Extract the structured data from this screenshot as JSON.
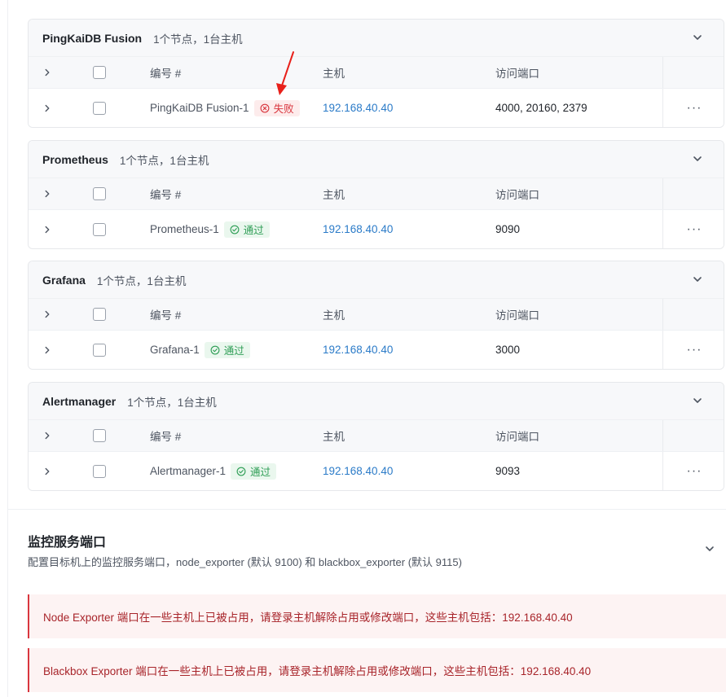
{
  "groups": [
    {
      "title": "PingKaiDB Fusion",
      "summary": "1个节点，1台主机",
      "columns": {
        "id": "编号 #",
        "host": "主机",
        "port": "访问端口"
      },
      "row": {
        "id": "PingKaiDB Fusion-1",
        "status": "失败",
        "status_type": "fail",
        "host": "192.168.40.40",
        "port": "4000, 20160, 2379",
        "more": "···"
      }
    },
    {
      "title": "Prometheus",
      "summary": "1个节点，1台主机",
      "columns": {
        "id": "编号 #",
        "host": "主机",
        "port": "访问端口"
      },
      "row": {
        "id": "Prometheus-1",
        "status": "通过",
        "status_type": "pass",
        "host": "192.168.40.40",
        "port": "9090",
        "more": "···"
      }
    },
    {
      "title": "Grafana",
      "summary": "1个节点，1台主机",
      "columns": {
        "id": "编号 #",
        "host": "主机",
        "port": "访问端口"
      },
      "row": {
        "id": "Grafana-1",
        "status": "通过",
        "status_type": "pass",
        "host": "192.168.40.40",
        "port": "3000",
        "more": "···"
      }
    },
    {
      "title": "Alertmanager",
      "summary": "1个节点，1台主机",
      "columns": {
        "id": "编号 #",
        "host": "主机",
        "port": "访问端口"
      },
      "row": {
        "id": "Alertmanager-1",
        "status": "通过",
        "status_type": "pass",
        "host": "192.168.40.40",
        "port": "9093",
        "more": "···"
      }
    }
  ],
  "monitor_section": {
    "title": "监控服务端口",
    "description": "配置目标机上的监控服务端口，node_exporter (默认 9100) 和 blackbox_exporter (默认 9115)"
  },
  "alerts": [
    "Node Exporter 端口在一些主机上已被占用，请登录主机解除占用或修改端口，这些主机包括：192.168.40.40",
    "Blackbox Exporter 端口在一些主机上已被占用，请登录主机解除占用或修改端口，这些主机包括：192.168.40.40"
  ],
  "colors": {
    "link": "#2b7bc8",
    "fail": "#d9363e",
    "pass": "#2f9e56",
    "annotation_arrow": "#e8201a"
  },
  "icons": {
    "expand": "chevron-right-icon",
    "collapse": "chevron-down-icon",
    "fail": "x-circle-icon",
    "pass": "check-circle-icon",
    "more": "more-dots-icon"
  }
}
